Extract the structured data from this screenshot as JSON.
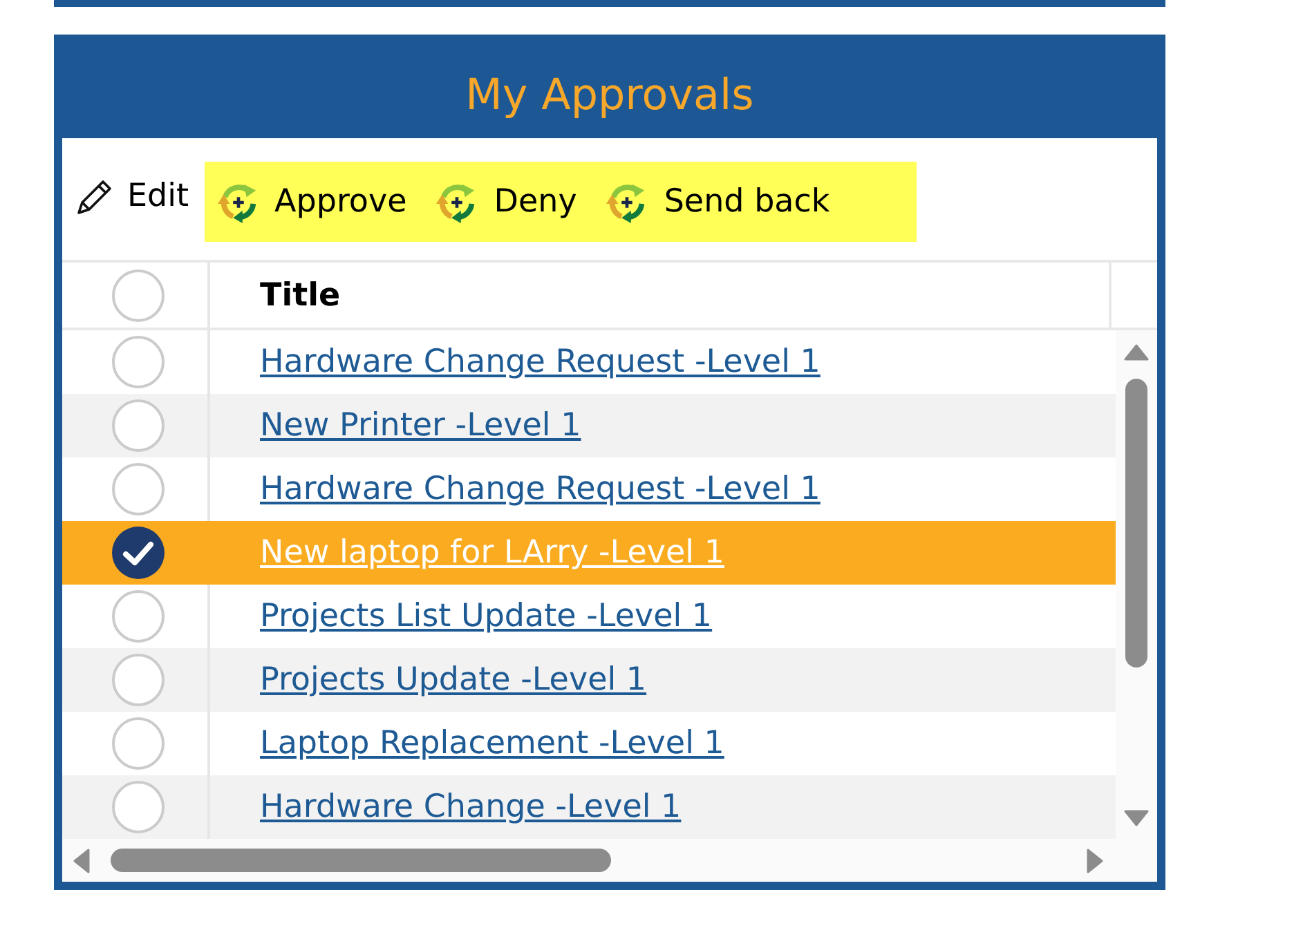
{
  "panel": {
    "title": "My Approvals",
    "toolbar": {
      "edit_button": {
        "label": "Edit"
      },
      "highlighted_buttons": [
        {
          "label": "Approve"
        },
        {
          "label": "Deny"
        },
        {
          "label": "Send back"
        }
      ]
    },
    "grid": {
      "select_all": {
        "checked": false
      },
      "columns": [
        {
          "label": "Title"
        }
      ],
      "rows": [
        {
          "title": "Hardware Change Request -Level 1",
          "selected": false
        },
        {
          "title": "New Printer -Level 1",
          "selected": false
        },
        {
          "title": "Hardware Change Request -Level 1",
          "selected": false
        },
        {
          "title": "New laptop for LArry -Level 1",
          "selected": true
        },
        {
          "title": "Projects List Update -Level 1",
          "selected": false
        },
        {
          "title": "Projects Update -Level 1",
          "selected": false
        },
        {
          "title": "Laptop Replacement -Level 1",
          "selected": false
        },
        {
          "title": "Hardware Change -Level 1",
          "selected": false
        }
      ]
    }
  }
}
